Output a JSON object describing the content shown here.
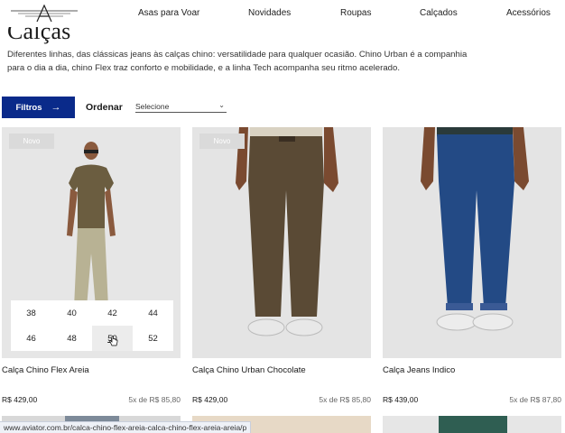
{
  "header": {
    "nav": [
      {
        "label": "Asas para Voar"
      },
      {
        "label": "Novidades"
      },
      {
        "label": "Roupas"
      },
      {
        "label": "Calçados"
      },
      {
        "label": "Acessórios"
      }
    ]
  },
  "page": {
    "title": "Calças",
    "description": "Diferentes linhas, das clássicas jeans às calças chino: versatilidade para qualquer ocasião. Chino Urban é a companhia para o dia a dia, chino Flex traz conforto e mobilidade, e a linha Tech acompanha seu ritmo acelerado."
  },
  "toolbar": {
    "filters_label": "Filtros",
    "sort_label": "Ordenar",
    "sort_value": "Selecione"
  },
  "products": [
    {
      "badge": "Novo",
      "name": "Calça Chino Flex Areia",
      "price": "R$ 429,00",
      "installments": "5x de R$ 85,80",
      "sizes": [
        "38",
        "40",
        "42",
        "44",
        "46",
        "48",
        "50",
        "52"
      ],
      "hovered_size": "50"
    },
    {
      "badge": "Novo",
      "name": "Calça Chino Urban Chocolate",
      "price": "R$ 429,00",
      "installments": "5x de R$ 85,80"
    },
    {
      "name": "Calça Jeans Indico",
      "price": "R$ 439,00",
      "installments": "5x de R$ 87,80"
    }
  ],
  "status_bar": {
    "url": "www.aviator.com.br/calca-chino-flex-areia-calca-chino-flex-areia-areia/p"
  },
  "colors": {
    "accent": "#0a2a8a",
    "image_bg": "#e4e4e4",
    "pants_sand": "#b8b294",
    "pants_chocolate": "#5a4a35",
    "pants_denim": "#234a85"
  }
}
